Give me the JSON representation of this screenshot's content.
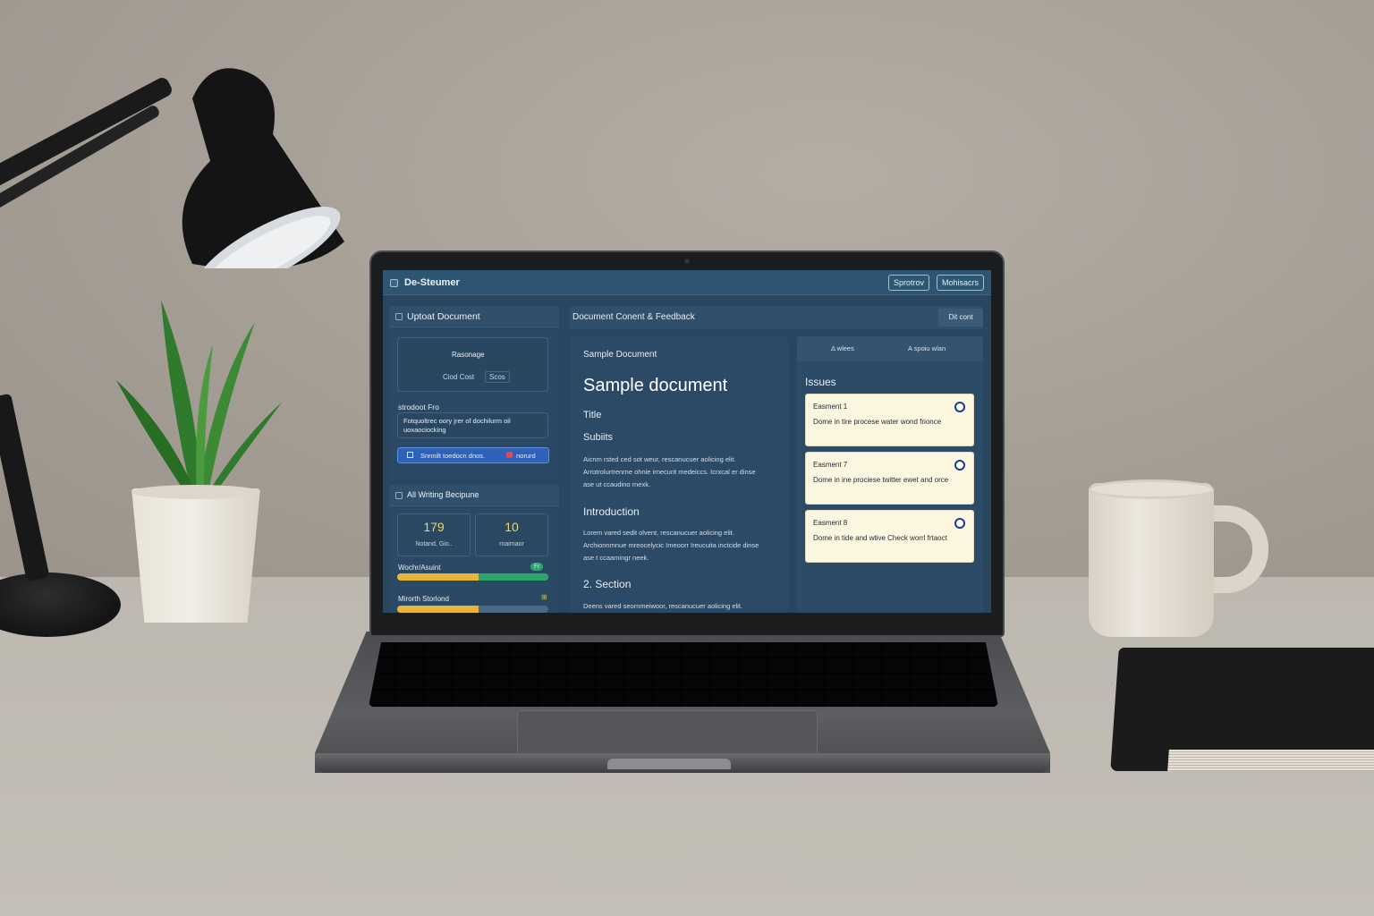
{
  "app": {
    "title": "De-Steumer",
    "top_buttons": [
      "Sprotrov",
      "Mohisacrs"
    ]
  },
  "upload_panel": {
    "title": "Uptoat Document",
    "drop_label": "Rasonage",
    "drop_actions": [
      "Ciod Cost",
      "Scos"
    ],
    "field_label": "strodoot Fro",
    "field_text": "Fotquoltrec oory jrer of dochilurm oil uoxaociocking",
    "primary_button": "Snnnilt toedocn dnos.",
    "primary_button_badge": "norurd"
  },
  "writing_panel": {
    "title": "All Writing Becipune",
    "stats": [
      {
        "value": "179",
        "label": "Notand, Gio.."
      },
      {
        "value": "10",
        "label": "rnaimaor"
      }
    ],
    "bars": [
      {
        "label": "Wochr/Asuint",
        "badge": "Fr",
        "fill_primary": 0.54,
        "fill_secondary": 0.46
      },
      {
        "label": "Mirorth Storlond",
        "badge": "⊞",
        "fill_primary": 0.54,
        "fill_secondary": 0
      }
    ]
  },
  "content_panel": {
    "title": "Document Conent & Feedback",
    "action_button": "Dit cont"
  },
  "document": {
    "header": "Sample Document",
    "heading": "Sample document",
    "title": "Title",
    "subtitle": "Subiits",
    "para1": [
      "Aicnm rsted ced sot weur, rescanucuer aolicing elit.",
      "Arrotrolurtrenrne ohnie irnecurit medeiccs. Icrxcal er dinse",
      "ase ut ccaudino rnexk."
    ],
    "section1": "Introduction",
    "para2": [
      "Lorem vared sedit olvent, rescanucuer aolicing elit.",
      "Archionnmnue mreocelycic Imeoorr Ireucuita inctcide dinse",
      "ase t ccaamingr neek."
    ],
    "section2": "2. Section",
    "para3": [
      "Deens vared seornmeiwoor, rescanucuer aolicing elit."
    ]
  },
  "issues_panel": {
    "tabs": [
      "Δ wlees",
      "A spoiu wlan"
    ],
    "title": "Issues",
    "items": [
      {
        "title": "Easment 1",
        "text": "Dome in tire procese water wond frionce"
      },
      {
        "title": "Easment 7",
        "text": "Dome in ine prociese twitter ewet and orce"
      },
      {
        "title": "Easment 8",
        "text": "Dome in tide and wtive Check worrl frtaoct"
      }
    ]
  }
}
